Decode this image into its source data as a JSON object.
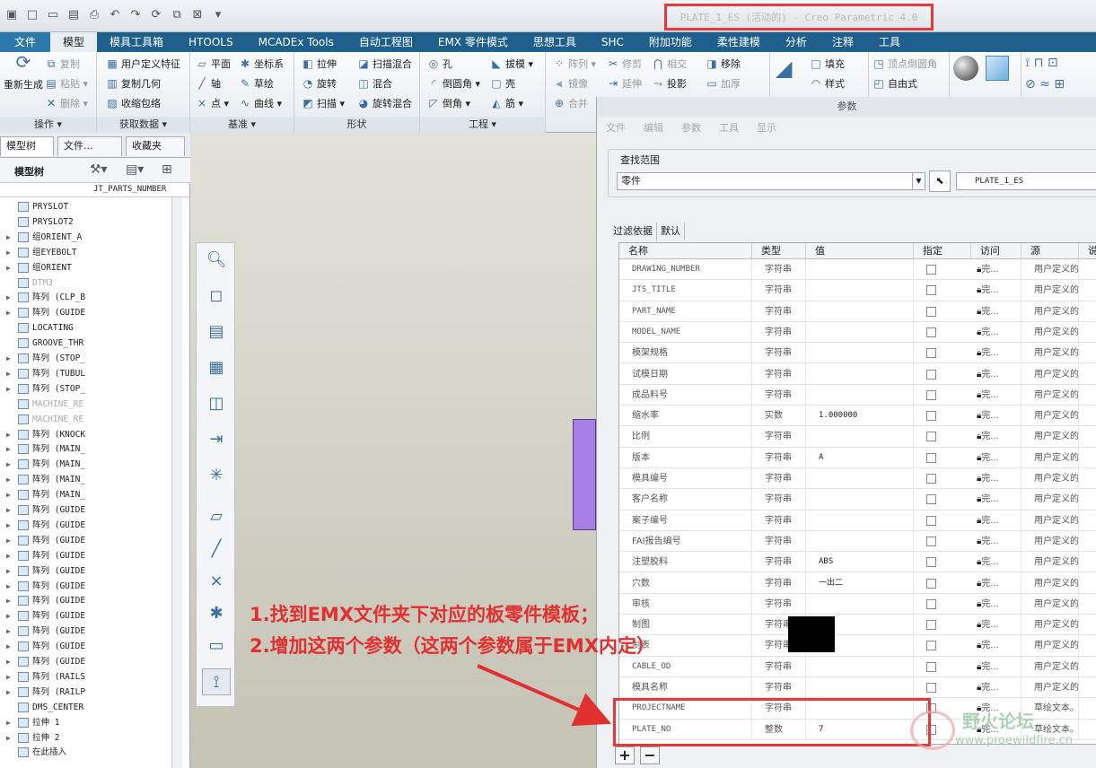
{
  "window_title": "PLATE_1_ES (活动的) - Creo Parametric 4.0",
  "ribbon_tabs": [
    "文件",
    "模型",
    "模具工具箱",
    "HTOOLS",
    "MCADEx Tools",
    "自动工程图",
    "EMX 零件模式",
    "思想工具",
    "SHC",
    "附加功能",
    "柔性建模",
    "分析",
    "注释",
    "工具"
  ],
  "ribbon": {
    "groups": {
      "operations": "操作 ▾",
      "get_data": "获取数据 ▾",
      "datum": "基准 ▾",
      "shapes": "形状",
      "engineering": "工程 ▾"
    },
    "regenerate": "重新生成",
    "copy": "复制",
    "paste": "粘贴 ▾",
    "delete": "删除 ▾",
    "udf": "用户定义特征",
    "copy_geom": "复制几何",
    "shrinkwrap": "收缩包络",
    "plane": "平面",
    "axis": "轴",
    "point": "点 ▾",
    "csys": "坐标系",
    "sketch": "草绘",
    "curve": "曲线 ▾",
    "extrude": "拉伸",
    "revolve": "旋转",
    "sweep": "扫描 ▾",
    "swept_blend": "扫描混合",
    "blend": "混合",
    "rot_blend": "旋转混合",
    "hole": "孔",
    "round": "倒圆角 ▾",
    "chamfer": "倒角 ▾",
    "draft": "拔模 ▾",
    "shell": "壳",
    "rib": "筋 ▾",
    "pattern": "阵列 ▾",
    "mirror": "镜像",
    "merge": "合并",
    "trim": "修剪",
    "extend": "延伸",
    "intersect": "相交",
    "project": "投影",
    "move": "移除",
    "thicken": "加厚",
    "fill": "填充",
    "style": "样式",
    "vertex_round": "顶点倒圆角",
    "freeform": "自由式"
  },
  "left_panel": {
    "tabs": [
      "模型树",
      "文件...",
      "收藏夹"
    ],
    "header": "模型树",
    "column": "JT_PARTS_NUMBER",
    "items": [
      {
        "label": "PRYSLOT",
        "exp": "",
        "dim": false
      },
      {
        "label": "PRYSLOT2",
        "exp": "",
        "dim": false
      },
      {
        "label": "组ORIENT_A",
        "exp": "▶",
        "dim": false
      },
      {
        "label": "组EYEBOLT",
        "exp": "▶",
        "dim": false
      },
      {
        "label": "组ORIENT",
        "exp": "▶",
        "dim": false
      },
      {
        "label": "DTM3",
        "exp": "",
        "dim": true
      },
      {
        "label": "阵列 (CLP_B",
        "exp": "▶",
        "dim": false
      },
      {
        "label": "阵列 (GUIDE",
        "exp": "▶",
        "dim": false
      },
      {
        "label": "LOCATING",
        "exp": "",
        "dim": false
      },
      {
        "label": "GROOVE_THR",
        "exp": "",
        "dim": false
      },
      {
        "label": "阵列 (STOP_",
        "exp": "▶",
        "dim": false
      },
      {
        "label": "阵列 (TUBUL",
        "exp": "▶",
        "dim": false
      },
      {
        "label": "阵列 (STOP_",
        "exp": "▶",
        "dim": false
      },
      {
        "label": "MACHINE_RE",
        "exp": "",
        "dim": true
      },
      {
        "label": "MACHINE_RE",
        "exp": "",
        "dim": true
      },
      {
        "label": "阵列 (KNOCK",
        "exp": "▶",
        "dim": false
      },
      {
        "label": "阵列 (MAIN_",
        "exp": "▶",
        "dim": false
      },
      {
        "label": "阵列 (MAIN_",
        "exp": "▶",
        "dim": false
      },
      {
        "label": "阵列 (MAIN_",
        "exp": "▶",
        "dim": false
      },
      {
        "label": "阵列 (MAIN_",
        "exp": "▶",
        "dim": false
      },
      {
        "label": "阵列 (GUIDE",
        "exp": "▶",
        "dim": false
      },
      {
        "label": "阵列 (GUIDE",
        "exp": "▶",
        "dim": false
      },
      {
        "label": "阵列 (GUIDE",
        "exp": "▶",
        "dim": false
      },
      {
        "label": "阵列 (GUIDE",
        "exp": "▶",
        "dim": false
      },
      {
        "label": "阵列 (GUIDE",
        "exp": "▶",
        "dim": false
      },
      {
        "label": "阵列 (GUIDE",
        "exp": "▶",
        "dim": false
      },
      {
        "label": "阵列 (GUIDE",
        "exp": "▶",
        "dim": false
      },
      {
        "label": "阵列 (GUIDE",
        "exp": "▶",
        "dim": false
      },
      {
        "label": "阵列 (GUIDE",
        "exp": "▶",
        "dim": false
      },
      {
        "label": "阵列 (GUIDE",
        "exp": "▶",
        "dim": false
      },
      {
        "label": "阵列 (GUIDE",
        "exp": "▶",
        "dim": false
      },
      {
        "label": "阵列 (RAILS",
        "exp": "▶",
        "dim": false
      },
      {
        "label": "阵列 (RAILP",
        "exp": "▶",
        "dim": false
      },
      {
        "label": "DMS_CENTER",
        "exp": "",
        "dim": false
      },
      {
        "label": "拉伸 1",
        "exp": "▶",
        "dim": false
      },
      {
        "label": "拉伸 2",
        "exp": "▶",
        "dim": false
      },
      {
        "label": "在此插入",
        "exp": "",
        "dim": false
      }
    ]
  },
  "dialog": {
    "title": "参数",
    "menu": [
      "文件",
      "编辑",
      "参数",
      "工具",
      "显示"
    ],
    "scope_label": "查找范围",
    "scope_value": "零件",
    "part_name": "PLATE_1_ES",
    "filter_tabs": [
      "过滤依据",
      "默认"
    ],
    "columns": [
      "名称",
      "类型",
      "值",
      "指定",
      "访问",
      "源",
      "说明"
    ],
    "rows": [
      {
        "name": "DRAWING_NUMBER",
        "type": "字符串",
        "value": "",
        "access": "完...",
        "source": "用户定义的",
        "mono": true
      },
      {
        "name": "JTS_TITLE",
        "type": "字符串",
        "value": "",
        "access": "完...",
        "source": "用户定义的",
        "mono": true
      },
      {
        "name": "PART_NAME",
        "type": "字符串",
        "value": "",
        "access": "完...",
        "source": "用户定义的",
        "mono": true
      },
      {
        "name": "MODEL_NAME",
        "type": "字符串",
        "value": "",
        "access": "完...",
        "source": "用户定义的",
        "mono": true
      },
      {
        "name": "模架规格",
        "type": "字符串",
        "value": "",
        "access": "完...",
        "source": "用户定义的",
        "mono": false
      },
      {
        "name": "试模日期",
        "type": "字符串",
        "value": "",
        "access": "完...",
        "source": "用户定义的",
        "mono": false
      },
      {
        "name": "成品料号",
        "type": "字符串",
        "value": "",
        "access": "完...",
        "source": "用户定义的",
        "mono": false
      },
      {
        "name": "缩水率",
        "type": "实数",
        "value": "1.000000",
        "access": "完...",
        "source": "用户定义的",
        "mono": false
      },
      {
        "name": "比例",
        "type": "字符串",
        "value": "",
        "access": "完...",
        "source": "用户定义的",
        "mono": false
      },
      {
        "name": "版本",
        "type": "字符串",
        "value": "A",
        "access": "完...",
        "source": "用户定义的",
        "mono": false
      },
      {
        "name": "模具编号",
        "type": "字符串",
        "value": "",
        "access": "完...",
        "source": "用户定义的",
        "mono": false
      },
      {
        "name": "客户名称",
        "type": "字符串",
        "value": "",
        "access": "完...",
        "source": "用户定义的",
        "mono": false
      },
      {
        "name": "案子编号",
        "type": "字符串",
        "value": "",
        "access": "完...",
        "source": "用户定义的",
        "mono": false
      },
      {
        "name": "FAI报告编号",
        "type": "字符串",
        "value": "",
        "access": "完...",
        "source": "用户定义的",
        "mono": false
      },
      {
        "name": "注塑胶料",
        "type": "字符串",
        "value": "ABS",
        "access": "完...",
        "source": "用户定义的",
        "mono": false
      },
      {
        "name": "穴数",
        "type": "字符串",
        "value": "一出二",
        "access": "完...",
        "source": "用户定义的",
        "mono": false
      },
      {
        "name": "审核",
        "type": "字符串",
        "value": "",
        "access": "完...",
        "source": "用户定义的",
        "mono": false
      },
      {
        "name": "制图",
        "type": "字符串",
        "value": "",
        "access": "完...",
        "source": "用户定义的",
        "mono": false
      },
      {
        "name": "制表",
        "type": "字符串",
        "value": "",
        "access": "完...",
        "source": "用户定义的",
        "mono": false
      },
      {
        "name": "CABLE_OD",
        "type": "字符串",
        "value": "",
        "access": "完...",
        "source": "用户定义的",
        "mono": true
      },
      {
        "name": "模具名称",
        "type": "字符串",
        "value": "",
        "access": "完...",
        "source": "用户定义的",
        "mono": false
      },
      {
        "name": "PROJECTNAME",
        "type": "字符串",
        "value": "",
        "access": "完...",
        "source": "草绘文本。",
        "mono": true
      },
      {
        "name": "PLATE_NO",
        "type": "整数",
        "value": "7",
        "access": "完...",
        "source": "草绘文本。",
        "mono": true
      }
    ],
    "add": "+",
    "remove": "−"
  },
  "annotation": [
    "1.找到EMX文件夹下对应的板零件模板；",
    "2.增加这两个参数（这两个参数属于EMX内定）"
  ],
  "watermark": {
    "title": "野火论坛",
    "url": "www.proewildfire.cn"
  },
  "colors": {
    "tab_bar": "#1f5f8b",
    "highlight": "#e03a3a",
    "purple_part": "#a77de6"
  }
}
